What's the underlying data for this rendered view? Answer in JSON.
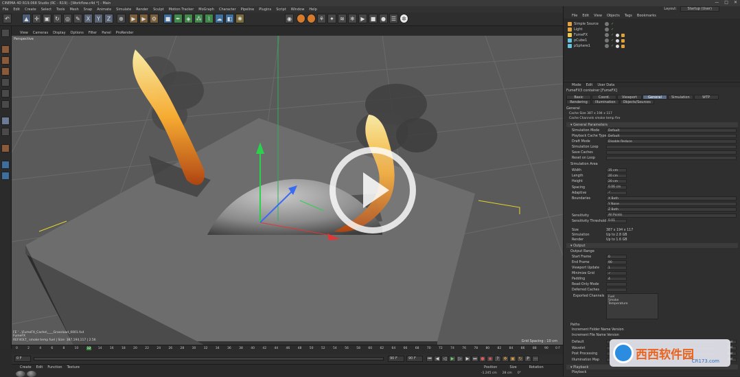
{
  "window": {
    "title": "CINEMA 4D R19.068 Studio (RC - R19) - [Workflow.c4d *] - Main",
    "controls": [
      "—",
      "□",
      "✕"
    ]
  },
  "menubar": [
    "File",
    "Edit",
    "Create",
    "Select",
    "Tools",
    "Mesh",
    "Snap",
    "Animate",
    "Simulate",
    "Render",
    "Sculpt",
    "Motion Tracker",
    "MoGraph",
    "Character",
    "Pipeline",
    "Plugins",
    "Script",
    "Window",
    "Help"
  ],
  "toolbar": {
    "xyz": [
      "X",
      "Y",
      "Z"
    ],
    "icons": [
      "undo-icon",
      "move-icon",
      "rotate-icon",
      "scale-icon",
      "cube-icon",
      "pen-icon",
      "subdivision-icon",
      "camera-icon",
      "light-icon"
    ]
  },
  "viewport": {
    "menu": [
      "View",
      "Cameras",
      "Display",
      "Options",
      "Filter",
      "Panel",
      "ProRender"
    ],
    "label": "Perspective",
    "grid_spacing": "Grid Spacing : 10 cm",
    "console": [
      "FE ' ..\\FumeFX_Cache\\____Grassload_0001.fxd",
      "FumeFX",
      "REF4OLT_ smoke temp fuel | Size: 387,194,117 | 2.56"
    ]
  },
  "timeline": {
    "ticks": [
      "0",
      "2",
      "4",
      "6",
      "8",
      "10",
      "12",
      "14",
      "16",
      "18",
      "20",
      "22",
      "24",
      "26",
      "28",
      "30",
      "32",
      "34",
      "36",
      "38",
      "40",
      "42",
      "44",
      "46",
      "48",
      "50",
      "52",
      "54",
      "56",
      "58",
      "60",
      "62",
      "64",
      "66",
      "68",
      "70",
      "72",
      "74",
      "76",
      "78",
      "80",
      "82",
      "84",
      "86",
      "88",
      "90"
    ],
    "current": "12",
    "end": "0 F",
    "start_field": "0 F",
    "end_field": "90 F",
    "end_field2": "90 F"
  },
  "material_bar": {
    "menu": [
      "Create",
      "Edit",
      "Function",
      "Texture"
    ]
  },
  "coord_bar": {
    "headers": [
      "Position",
      "Size",
      "Rotation"
    ],
    "values": [
      "-1.245 cm",
      "28 cm",
      "0°"
    ]
  },
  "layout": {
    "label": "Layout:",
    "value": "Startup (User)"
  },
  "objects": {
    "menu": [
      "File",
      "Edit",
      "View",
      "Objects",
      "Tags",
      "Bookmarks"
    ],
    "items": [
      {
        "name": "Simple Source",
        "color": "#e7a33e"
      },
      {
        "name": "Light",
        "color": "#e7a33e"
      },
      {
        "name": "FumeFX",
        "color": "#f2c94c"
      },
      {
        "name": "pCube1",
        "color": "#66c3e0"
      },
      {
        "name": "pSphere1",
        "color": "#66c3e0"
      }
    ]
  },
  "attributes": {
    "menu": [
      "Mode",
      "Edit",
      "User Data"
    ],
    "title": "FumeFX3 container [FumeFX]",
    "tabs_row1": [
      "Basic",
      "Coord.",
      "Viewport",
      "General",
      "Simulation",
      "WTP"
    ],
    "tabs_row2": [
      "Rendering",
      "Illumination",
      "Objects/Sources"
    ],
    "active_tab": "General",
    "general_label": "General",
    "cache_size": "Cache Size  387 x 194 x 117",
    "cache_channels": "Cache Channels  smoke temp fire",
    "sections": [
      "General Parameters",
      "Output",
      "Playback"
    ],
    "params": [
      {
        "label": "Simulation Mode",
        "value": "Default"
      },
      {
        "label": "Playback Cache Type",
        "value": "Default"
      },
      {
        "label": "Draft Mode",
        "value": "Disable Reduce"
      },
      {
        "label": "Simulation Loop",
        "value": ""
      },
      {
        "label": "Save Caches",
        "value": ""
      },
      {
        "label": "Reset on Loop",
        "value": ""
      }
    ],
    "sim_area": {
      "title": "Simulation Area",
      "fields": [
        {
          "label": "Width",
          "value": "35 cm"
        },
        {
          "label": "Length",
          "value": "20 cm"
        },
        {
          "label": "Height",
          "value": "20 cm"
        },
        {
          "label": "Spacing",
          "value": "0.06 cm"
        },
        {
          "label": "Adaptive",
          "value": "✓"
        },
        {
          "label": "Boundaries",
          "value": "X Both"
        },
        {
          "label": "",
          "value": "Y None"
        },
        {
          "label": "",
          "value": "Z Both"
        },
        {
          "label": "Sensitivity",
          "value": "All Points"
        },
        {
          "label": "Sensitivity Threshold",
          "value": "0.01"
        }
      ]
    },
    "info": [
      {
        "label": "Size",
        "value": "387 x 194 x 117"
      },
      {
        "label": "Simulation",
        "value": "Up to 2.8 GB"
      },
      {
        "label": "Render",
        "value": "Up to 1.6 GB"
      }
    ],
    "output": {
      "range_label": "Output Range",
      "fields": [
        {
          "label": "Start Frame",
          "value": "0"
        },
        {
          "label": "End Frame",
          "value": "90"
        },
        {
          "label": "Viewport Update",
          "value": "1"
        },
        {
          "label": "Minimize Grid",
          "value": "✓"
        },
        {
          "label": "Padding",
          "value": "4"
        },
        {
          "label": "Read-Only Mode",
          "value": ""
        },
        {
          "label": "Deferred Caches",
          "value": ""
        }
      ],
      "exported_label": "Exported Channels",
      "channels": [
        "Fuel",
        "Smoke",
        "Temperature"
      ]
    },
    "paths": {
      "label": "Paths",
      "rows": [
        "Increment Folder Name Version",
        "Increment File Name Version"
      ],
      "entries": [
        {
          "label": "Default",
          "btn": "Del"
        },
        {
          "label": "Wavelet",
          "btn": "Del"
        },
        {
          "label": "Post Processing",
          "btn": "Del"
        },
        {
          "label": "Illumination Map",
          "btn": "Del"
        }
      ]
    },
    "playback_row": "Playback"
  },
  "watermark": {
    "text": "西西软件园",
    "url": "CR173.com"
  }
}
